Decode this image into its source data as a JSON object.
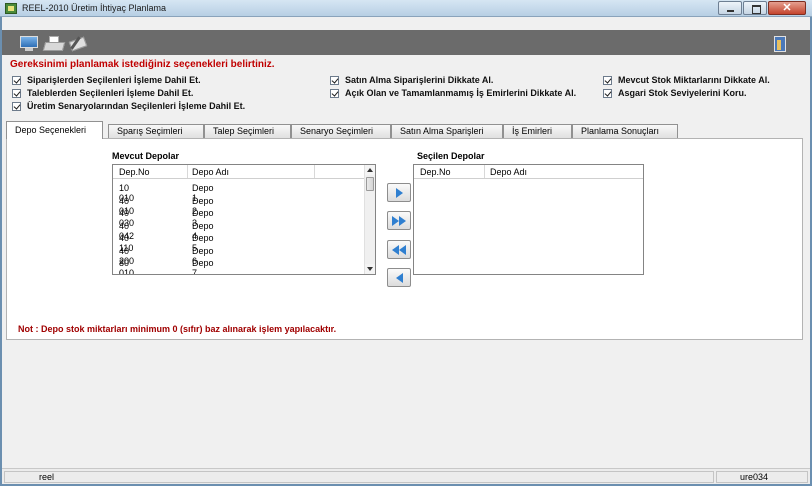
{
  "window": {
    "title": "REEL-2010 Üretim İhtiyaç Planlama"
  },
  "toolbar": {
    "icons": [
      "monitor-icon",
      "printer-icon",
      "tools-icon",
      "exit-door-icon"
    ]
  },
  "heading": "Gereksinimi planlamak istediğiniz seçenekleri belirtiniz.",
  "options": [
    {
      "label": "Siparişlerden Seçilenleri İşleme Dahil Et.",
      "checked": true
    },
    {
      "label": "Satın Alma Siparişlerini Dikkate Al.",
      "checked": true
    },
    {
      "label": "Mevcut Stok Miktarlarını Dikkate Al.",
      "checked": true
    },
    {
      "label": "Taleblerden Seçilenleri İşleme Dahil Et.",
      "checked": true
    },
    {
      "label": "Açık Olan ve Tamamlanmamış İş Emirlerini Dikkate Al.",
      "checked": true
    },
    {
      "label": "Asgari Stok Seviyelerini Koru.",
      "checked": true
    },
    {
      "label": "Üretim Senaryolarından Seçilenleri İşleme Dahil Et.",
      "checked": true
    }
  ],
  "tabs": [
    {
      "label": "Depo Seçenekleri",
      "active": true
    },
    {
      "label": "Sparış Seçimleri"
    },
    {
      "label": "Talep Seçimleri"
    },
    {
      "label": "Senaryo Seçimleri"
    },
    {
      "label": "Satın Alma Sparişleri"
    },
    {
      "label": "İş Emirleri"
    },
    {
      "label": "Planlama Sonuçları"
    }
  ],
  "available": {
    "title": "Mevcut Depolar",
    "columns": [
      "Dep.No",
      "Depo Adı"
    ],
    "rows": [
      [
        "10 010",
        "Depo 1"
      ],
      [
        "40 010",
        "Depo 2"
      ],
      [
        "40 030",
        "Depo 3"
      ],
      [
        "40 042",
        "Depo 4"
      ],
      [
        "40 110",
        "Depo 5"
      ],
      [
        "40 200",
        "Depo 6"
      ],
      [
        "80 010",
        "Depo 7"
      ]
    ]
  },
  "selected": {
    "title": "Seçilen Depolar",
    "columns": [
      "Dep.No",
      "Depo Adı"
    ]
  },
  "transfer_buttons": [
    "move-right-icon",
    "move-all-right-icon",
    "move-all-left-icon",
    "move-left-icon"
  ],
  "note": "Not : Depo stok miktarları minimum 0 (sıfır) baz alınarak işlem yapılacaktır.",
  "status": {
    "left": "reel",
    "right": "ure034"
  },
  "colors": {
    "accent": "#2f7fd0",
    "warning": "#c00000",
    "toolbar": "#6b6b6b"
  }
}
